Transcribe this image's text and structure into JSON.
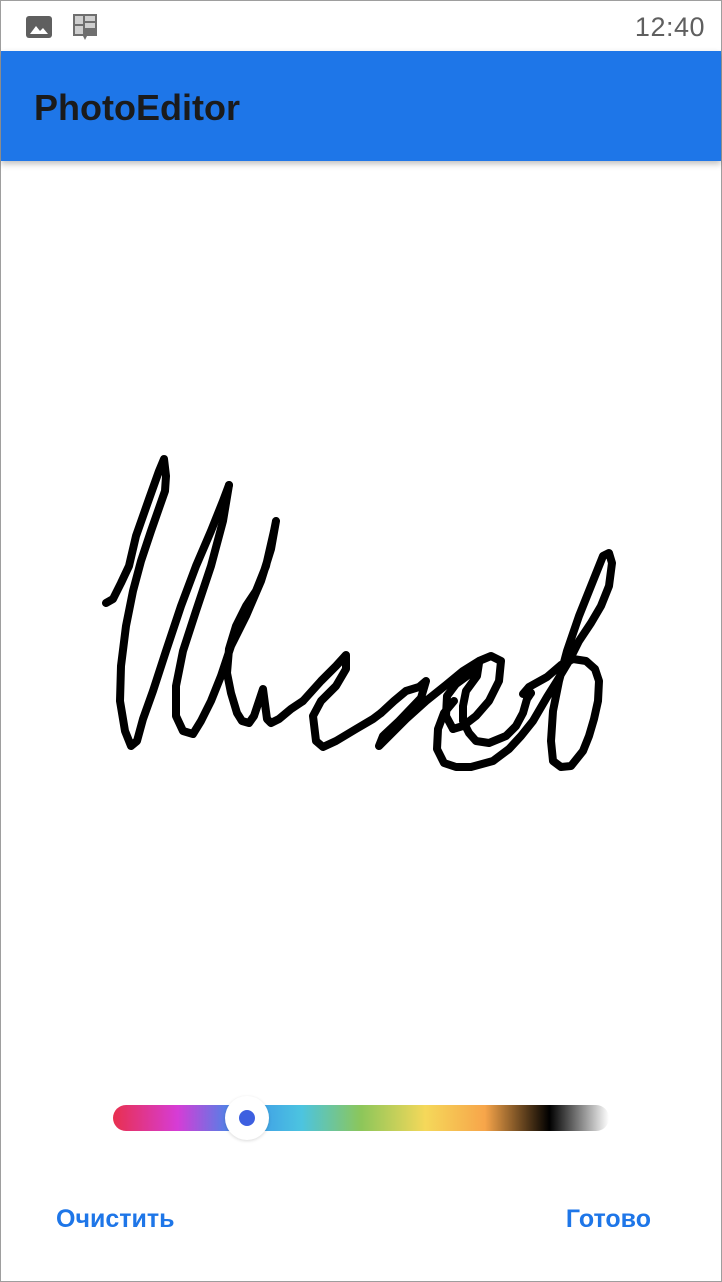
{
  "status_bar": {
    "time": "12:40",
    "icons": [
      "gallery-icon",
      "app-notification-icon"
    ]
  },
  "app_bar": {
    "title": "PhotoEditor",
    "background": "#1e76e8",
    "title_color": "#1b1b1b"
  },
  "drawing": {
    "stroke_color": "#000000"
  },
  "color_slider": {
    "value": 0.27,
    "selected_color": "#3d5fe0",
    "stops": [
      "#e8304f",
      "#d63cd6",
      "#3a8eea",
      "#4cc4e0",
      "#8cc65a",
      "#f5d85a",
      "#f7a54a",
      "#000000",
      "#ffffff"
    ]
  },
  "actions": {
    "clear_label": "Очистить",
    "done_label": "Готово",
    "accent": "#1e76e8"
  }
}
